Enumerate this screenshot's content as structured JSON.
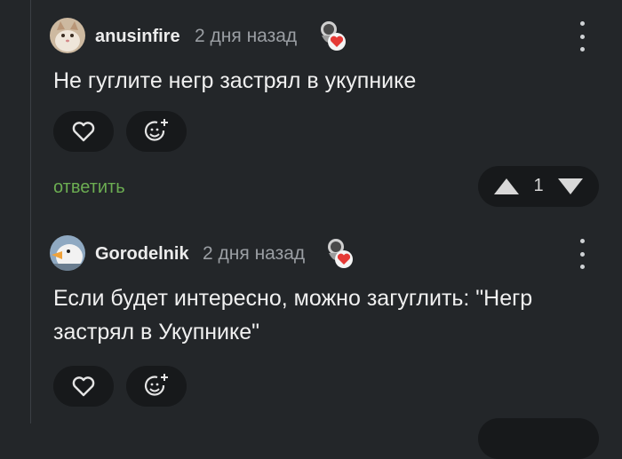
{
  "comments": [
    {
      "username": "anusinfire",
      "time": "2 дня назад",
      "avatar_icon": "cat-avatar-icon",
      "badge_icon": "heart-badge-icon",
      "text": "Не гуглите негр застрял в укупнике",
      "reply_label": "ответить",
      "rating": "1"
    },
    {
      "username": "Gorodelnik",
      "time": "2 дня назад",
      "avatar_icon": "goose-avatar-icon",
      "badge_icon": "heart-badge-icon",
      "text": "Если будет интересно, можно загуглить: \"Негр застрял в Укупнике\""
    }
  ],
  "colors": {
    "background": "#232629",
    "button_bg": "#17191b",
    "reply_green": "#6cad52",
    "meta_gray": "#9a9ea3",
    "heart_red": "#e53935"
  }
}
